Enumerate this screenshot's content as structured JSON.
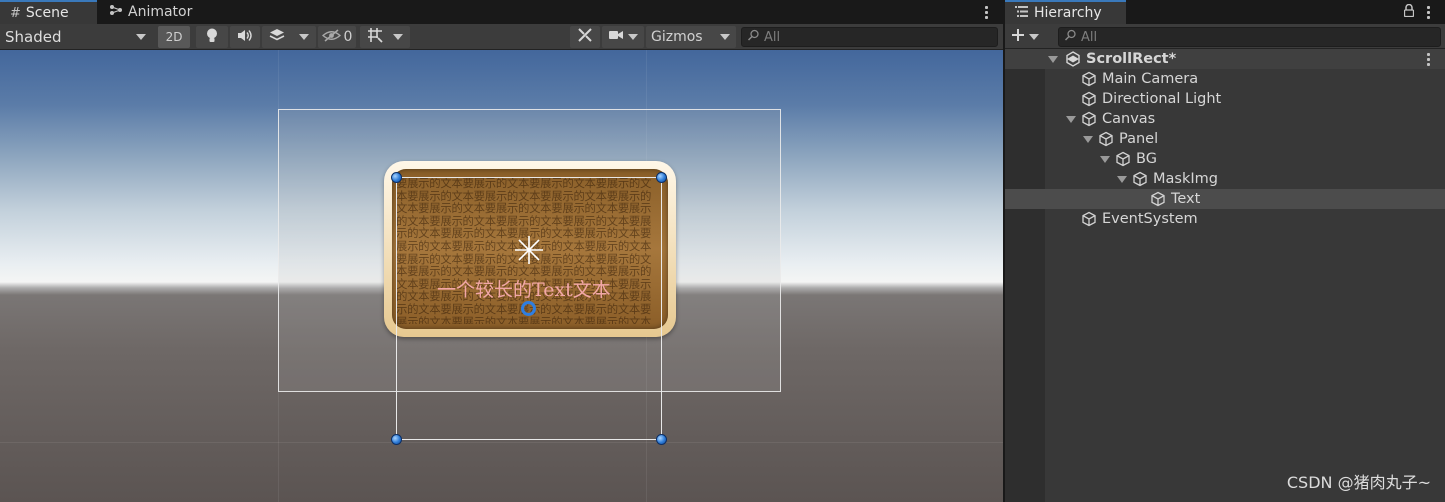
{
  "scene_panel": {
    "tabs": [
      {
        "label": "Scene",
        "icon": "grid-icon"
      },
      {
        "label": "Animator",
        "icon": "animator-icon"
      }
    ],
    "toolbar": {
      "draw_mode": "Shaded",
      "mode_2d": "2D",
      "hidden_count": "0",
      "gizmos_label": "Gizmos",
      "search_placeholder": "All"
    },
    "viewport": {
      "overlay_text": "一个较长的Text文本",
      "repeat_text": "要展示的文本要展示的文本要展示的文本要展示的文本要展示的文本要展示的文本要展示的文本要展示的文本要展示的文本要展示的文本要展示的文本要展示的文本要展示的文本要展示的文本要展示的文本要展示的文本要展示的文本要展示的文本要展示的文本要展示的文本要展示的文本要展示的文本要展示的文本要展示的文本要展示的文本要展示的文本要展示的文本要展示的文本要展示的文本要展示的文本要展示的文本要展示的文本要展示的文本要展示的文本要展示的文本要展示的文本要展示的文本要展示的文本要展示的文本要展示的文本要展示的文本要展示的文本要展示的文本要展示的文本要展示的文本要展示的文本要展示的文本要展示的文本要展示的文本要展示的文本要展示的文本要展示的文本要展示的文本要展示的文本要展示的文本要展示的文本要展示的文本要展示的文本要展示的文本要展示的文本要展示的文本要展示的文本要展示的文本要展示的文本要展示的文本要展示的文本要展示的文本要展示的文本要展示的文本要展示的文本要展示的文本要展示的文本要展示的文本要展示的文本要展示的文本要展示的文本要展示的文本要展示的文本要展示的文本要展示的文本"
    }
  },
  "hierarchy": {
    "tab_label": "Hierarchy",
    "search_placeholder": "All",
    "scene_name": "ScrollRect*",
    "items": [
      {
        "label": "Main Camera"
      },
      {
        "label": "Directional Light"
      },
      {
        "label": "Canvas"
      },
      {
        "label": "Panel"
      },
      {
        "label": "BG"
      },
      {
        "label": "MaskImg"
      },
      {
        "label": "Text"
      },
      {
        "label": "EventSystem"
      }
    ]
  },
  "watermark": "CSDN @猪肉丸子~",
  "colors": {
    "accent": "#3a79bb",
    "panel_bg": "#383838",
    "overlay_text": "#f2a7a7",
    "handle": "#2c7ad6"
  }
}
